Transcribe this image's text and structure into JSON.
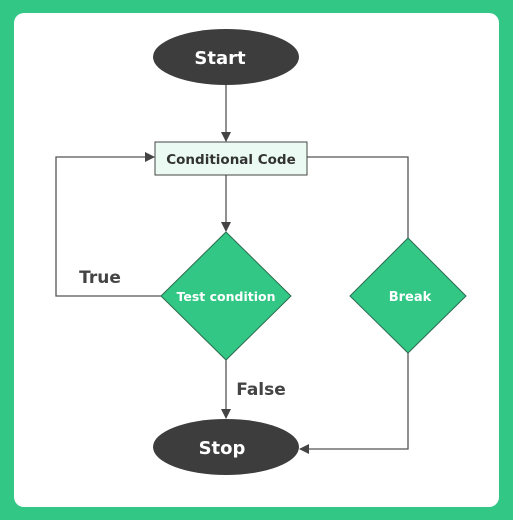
{
  "nodes": {
    "start": "Start",
    "conditional_code": "Conditional Code",
    "test_condition": "Test condition",
    "break": "Break",
    "stop": "Stop"
  },
  "edge_labels": {
    "true": "True",
    "false": "False"
  },
  "colors": {
    "background": "#33c786",
    "diamond": "#33c786",
    "terminal": "#3d3d3d",
    "process_fill": "#ebfbf4",
    "line": "#444444"
  }
}
